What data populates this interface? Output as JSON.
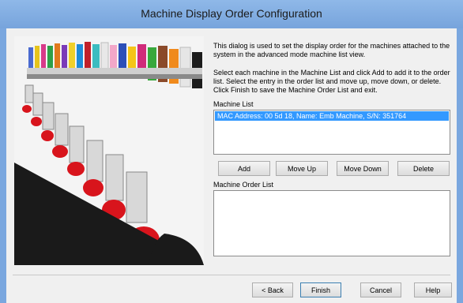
{
  "window": {
    "title": "Machine Display Order Configuration"
  },
  "description": {
    "paragraph1": "This dialog is used to set the display order for the machines attached to the system in the advanced mode machine list view.",
    "paragraph2": "Select each machine in the Machine List and click Add to add it to the order list. Select the entry in the order list and move up, move down, or delete. Click Finish to save the Machine Order List and exit."
  },
  "machine_list": {
    "label": "Machine List",
    "items": [
      "MAC Address: 00 5d 18, Name: Emb Machine, S/N: 351764"
    ],
    "selected_index": 0
  },
  "list_buttons": {
    "add": "Add",
    "move_up": "Move Up",
    "move_down": "Move Down",
    "delete": "Delete"
  },
  "order_list": {
    "label": "Machine Order List",
    "items": []
  },
  "footer_buttons": {
    "back": "< Back",
    "finish": "Finish",
    "cancel": "Cancel",
    "help": "Help"
  },
  "colors": {
    "title_bar": "#7aa7df",
    "selection": "#3399ff",
    "thread_red": "#d8141c"
  }
}
